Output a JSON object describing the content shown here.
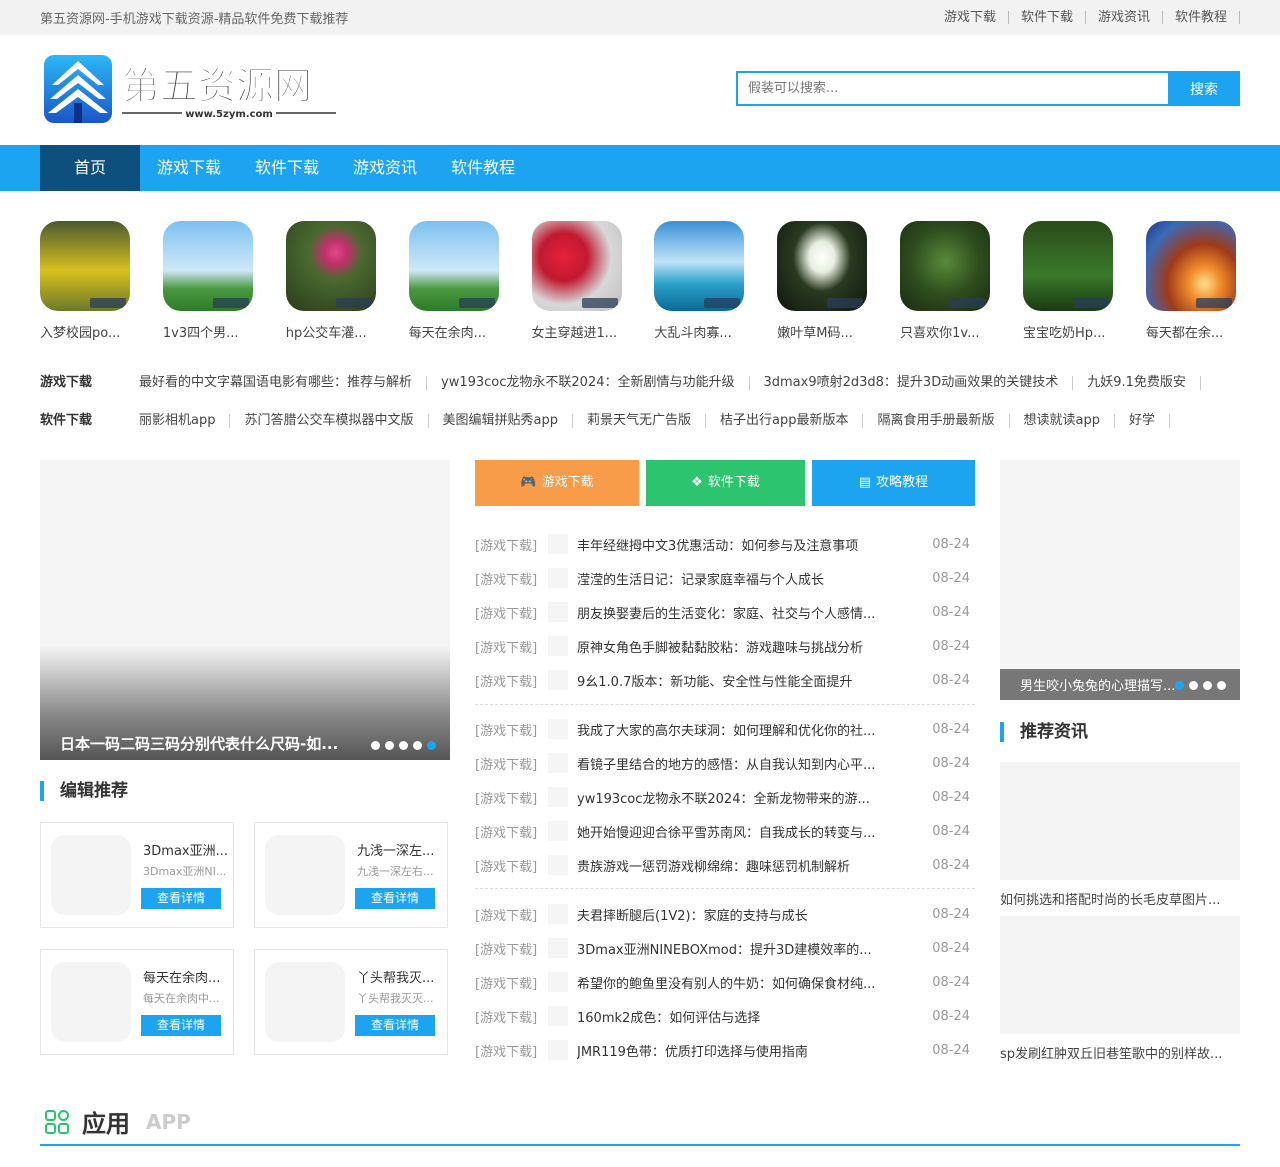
{
  "topbar": {
    "site_title": "第五资源网-手机游戏下载资源-精品软件免费下载推荐",
    "links": [
      "游戏下载",
      "软件下载",
      "游戏资讯",
      "软件教程"
    ]
  },
  "logo": {
    "text": "第五资源网",
    "url_text": "www.5zym.com"
  },
  "search": {
    "placeholder": "假装可以搜索...",
    "button": "搜索"
  },
  "nav": [
    "首页",
    "游戏下载",
    "软件下载",
    "游戏资讯",
    "软件教程"
  ],
  "icons": [
    {
      "label": "入梦校园po..."
    },
    {
      "label": "1v3四个男..."
    },
    {
      "label": "hp公交车灌..."
    },
    {
      "label": "每天在余肉..."
    },
    {
      "label": "女主穿越进1..."
    },
    {
      "label": "大乱斗肉寡..."
    },
    {
      "label": "嫩叶草M码..."
    },
    {
      "label": "只喜欢你1v..."
    },
    {
      "label": "宝宝吃奶Hp..."
    },
    {
      "label": "每天都在余..."
    }
  ],
  "game_links": {
    "cat": "游戏下载",
    "items": [
      "最好看的中文字幕国语电影有哪些：推荐与解析",
      "yw193coc龙物永不联2024：全新剧情与功能升级",
      "3dmax9喷射2d3d8：提升3D动画效果的关键技术",
      "九妖9.1免费版安"
    ]
  },
  "soft_links": {
    "cat": "软件下载",
    "items": [
      "丽影相机app",
      "苏门答腊公交车模拟器中文版",
      "美图编辑拼贴秀app",
      "莉景天气无广告版",
      "桔子出行app最新版本",
      "隔离食用手册最新版",
      "想读就读app",
      "好学"
    ]
  },
  "slider": {
    "caption": "日本一码二码三码分别代表什么尺码-如..."
  },
  "edit": {
    "title": "编辑推荐",
    "cards": [
      {
        "title": "3Dmax亚洲...",
        "sub": "3Dmax亚洲NI...",
        "btn": "查看详情"
      },
      {
        "title": "九浅一深左...",
        "sub": "九浅一深左右...",
        "btn": "查看详情"
      },
      {
        "title": "每天在余肉...",
        "sub": "每天在余肉中...",
        "btn": "查看详情"
      },
      {
        "title": "丫头帮我灭...",
        "sub": "丫头帮我灭灭...",
        "btn": "查看详情"
      }
    ]
  },
  "tabs": [
    {
      "label": "游戏下载",
      "color": "#f99c4a"
    },
    {
      "label": "软件下载",
      "color": "#2cc46e"
    },
    {
      "label": "攻略教程",
      "color": "#1ca4f0"
    }
  ],
  "news": [
    {
      "cat": "[游戏下载]",
      "title": "丰年经继拇中文3优惠活动：如何参与及注意事项",
      "date": "08-24"
    },
    {
      "cat": "[游戏下载]",
      "title": "滢滢的生活日记：记录家庭幸福与个人成长",
      "date": "08-24"
    },
    {
      "cat": "[游戏下载]",
      "title": "朋友换娶妻后的生活变化：家庭、社交与个人感情...",
      "date": "08-24"
    },
    {
      "cat": "[游戏下载]",
      "title": "原神女角色手脚被黏黏胶粘：游戏趣味与挑战分析",
      "date": "08-24"
    },
    {
      "cat": "[游戏下载]",
      "title": "9幺1.0.7版本：新功能、安全性与性能全面提升",
      "date": "08-24"
    },
    {
      "cat": "[游戏下载]",
      "title": "我成了大家的高尔夫球洞：如何理解和优化你的社...",
      "date": "08-24"
    },
    {
      "cat": "[游戏下载]",
      "title": "看镜子里结合的地方的感悟：从自我认知到内心平...",
      "date": "08-24"
    },
    {
      "cat": "[游戏下载]",
      "title": "yw193coc龙物永不联2024：全新龙物带来的游...",
      "date": "08-24"
    },
    {
      "cat": "[游戏下载]",
      "title": "她开始慢迎迎合徐平雪苏南风：自我成长的转变与...",
      "date": "08-24"
    },
    {
      "cat": "[游戏下载]",
      "title": "贵族游戏一惩罚游戏柳绵绵：趣味惩罚机制解析",
      "date": "08-24"
    },
    {
      "cat": "[游戏下载]",
      "title": "夫君摔断腿后(1V2)：家庭的支持与成长",
      "date": "08-24"
    },
    {
      "cat": "[游戏下载]",
      "title": "3Dmax亚洲NINEBOXmod：提升3D建模效率的...",
      "date": "08-24"
    },
    {
      "cat": "[游戏下载]",
      "title": "希望你的鲍鱼里没有别人的牛奶：如何确保食材纯...",
      "date": "08-24"
    },
    {
      "cat": "[游戏下载]",
      "title": "160mk2成色：如何评估与选择",
      "date": "08-24"
    },
    {
      "cat": "[游戏下载]",
      "title": "JMR119色带：优质打印选择与使用指南",
      "date": "08-24"
    }
  ],
  "rslider": {
    "caption": "男生咬小兔兔的心理描写..."
  },
  "recommend": {
    "title": "推荐资讯",
    "items": [
      {
        "caption": "如何挑选和搭配时尚的长毛皮草图片..."
      },
      {
        "caption": "sp发刷红肿双丘旧巷笙歌中的别样故..."
      }
    ]
  },
  "app_section": {
    "title": "应用",
    "en": "APP"
  },
  "colors": {
    "accent": "#1ca4f0",
    "nav_active": "#0d4f7d"
  }
}
